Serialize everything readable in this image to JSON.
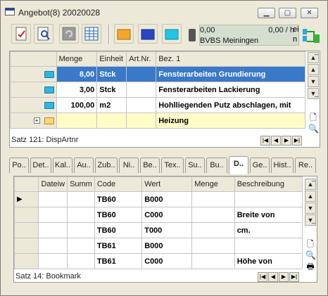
{
  "window": {
    "title": "Angebot(8) 20020028"
  },
  "toolbar": {
    "status": {
      "value1": "0,00",
      "value2": "0,00 / h",
      "label": "BVBS Meiningen"
    },
    "right_text": [
      "ei",
      "n"
    ]
  },
  "top_grid": {
    "columns": [
      "Menge",
      "Einheit",
      "Art.Nr.",
      "Bez. 1"
    ],
    "rows": [
      {
        "menge": "8,00",
        "einheit": "Stck",
        "artnr": "",
        "bez": "Fensterarbeiten Grundierung"
      },
      {
        "menge": "3,00",
        "einheit": "Stck",
        "artnr": "",
        "bez": "Fensterarbeiten Lackierung"
      },
      {
        "menge": "100,00",
        "einheit": "m2",
        "artnr": "",
        "bez": "Hohlliegenden Putz abschlagen, mit"
      },
      {
        "menge": "",
        "einheit": "",
        "artnr": "",
        "bez": "Heizung"
      }
    ],
    "status": "Satz 121: DispArtnr"
  },
  "tabs": [
    "Po..",
    "Det..",
    "Kal..",
    "Au..",
    "Zub..",
    "Ni..",
    "Be..",
    "Tex..",
    "Su..",
    "Bu..",
    "D..",
    "Ge..",
    "Hist..",
    "Re.."
  ],
  "active_tab": "D..",
  "bottom_grid": {
    "columns": [
      "Dateiw",
      "Summ",
      "Code",
      "Wert",
      "Menge",
      "Beschreibung"
    ],
    "rows": [
      {
        "code": "TB60",
        "wert": "B000",
        "menge": "",
        "beschreibung": ""
      },
      {
        "code": "TB60",
        "wert": "C000",
        "menge": "",
        "beschreibung": "Breite von"
      },
      {
        "code": "TB60",
        "wert": "T000",
        "menge": "",
        "beschreibung": "cm."
      },
      {
        "code": "TB61",
        "wert": "B000",
        "menge": "",
        "beschreibung": ""
      },
      {
        "code": "TB61",
        "wert": "C000",
        "menge": "",
        "beschreibung": "Höhe von"
      }
    ],
    "status": "Satz 14: Bookmark"
  },
  "colors": {
    "selection": "#3a78c8",
    "highlight_row": "#fffcc8",
    "chrome": "#ece9d8"
  }
}
